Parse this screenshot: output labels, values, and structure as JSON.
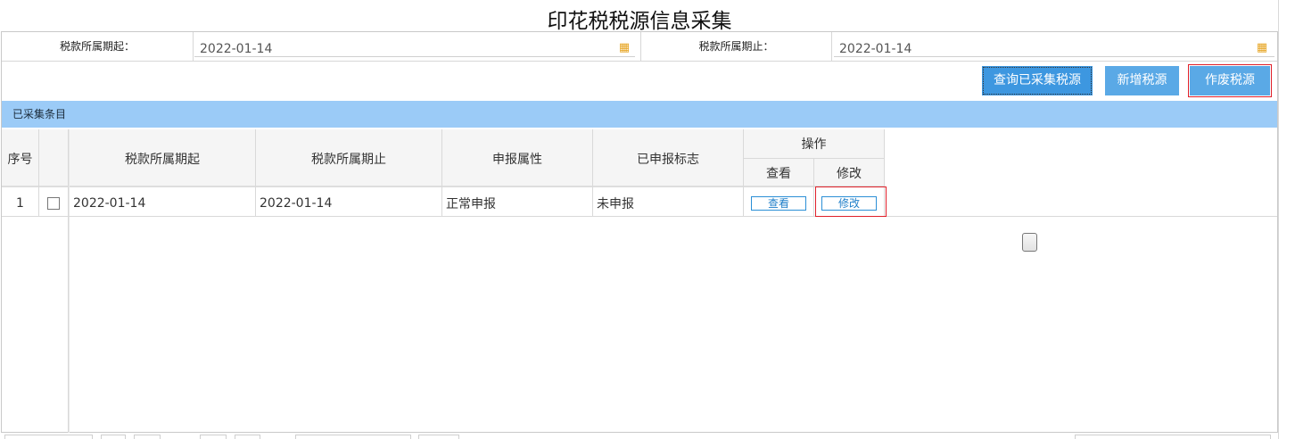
{
  "page": {
    "title": "印花税税源信息采集"
  },
  "filters": {
    "start_label": "税款所属期起：",
    "start_value": "2022-01-14",
    "end_label": "税款所属期止：",
    "end_value": "2022-01-14"
  },
  "toolbar": {
    "query_label": "查询已采集税源",
    "add_label": "新增税源",
    "void_label": "作废税源"
  },
  "section": {
    "title": "已采集条目"
  },
  "table": {
    "headers": {
      "index": "序号",
      "start": "税款所属期起",
      "end": "税款所属期止",
      "attr": "申报属性",
      "flag": "已申报标志",
      "ops": "操作",
      "view": "查看",
      "edit": "修改"
    },
    "rows": [
      {
        "index": "1",
        "start": "2022-01-14",
        "end": "2022-01-14",
        "attr": "正常申报",
        "flag": "未申报",
        "view": "查看",
        "edit": "修改"
      }
    ]
  },
  "icons": {
    "calendar": "calendar-icon"
  },
  "colors": {
    "primary_button": "#5aa9e6",
    "section_bar": "#9bcbf7",
    "highlight": "#e0202a",
    "calendar": "#e6a31e"
  }
}
